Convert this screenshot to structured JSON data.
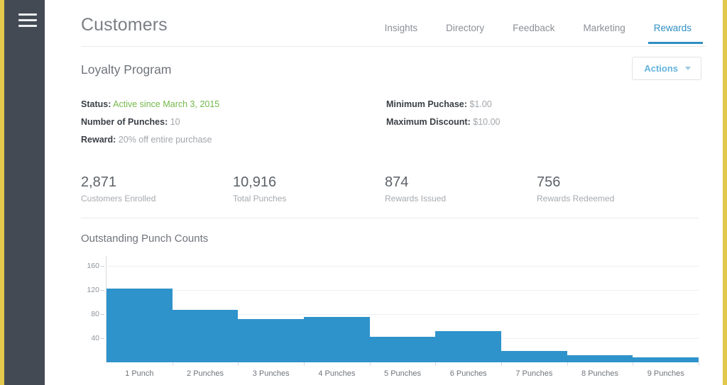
{
  "sidebar": {
    "menu_icon": "hamburger-menu-icon"
  },
  "header": {
    "title": "Customers",
    "tabs": [
      {
        "label": "Insights",
        "active": false
      },
      {
        "label": "Directory",
        "active": false
      },
      {
        "label": "Feedback",
        "active": false
      },
      {
        "label": "Marketing",
        "active": false
      },
      {
        "label": "Rewards",
        "active": true
      }
    ]
  },
  "section": {
    "title": "Loyalty Program",
    "actions_label": "Actions",
    "actions_icon": "chevron-down-icon"
  },
  "details": {
    "left": [
      {
        "label": "Status:",
        "value": "Active since March 3, 2015",
        "style": "green"
      },
      {
        "label": "Number of Punches:",
        "value": "10",
        "style": "muted"
      },
      {
        "label": "Reward:",
        "value": "20% off entire purchase",
        "style": "muted"
      }
    ],
    "right": [
      {
        "label": "Minimum Puchase:",
        "value": "$1.00",
        "style": "muted"
      },
      {
        "label": "Maximum Discount:",
        "value": "$10.00",
        "style": "muted"
      }
    ]
  },
  "stats": [
    {
      "value": "2,871",
      "label": "Customers Enrolled"
    },
    {
      "value": "10,916",
      "label": "Total Punches"
    },
    {
      "value": "874",
      "label": "Rewards Issued"
    },
    {
      "value": "756",
      "label": "Rewards Redeemed"
    }
  ],
  "chart_data": {
    "type": "bar",
    "title": "Outstanding Punch Counts",
    "xlabel": "",
    "ylabel": "",
    "categories": [
      "1 Punch",
      "2 Punches",
      "3 Punches",
      "4 Punches",
      "5 Punches",
      "6 Punches",
      "7 Punches",
      "8 Punches",
      "9 Punches"
    ],
    "values": [
      122,
      87,
      72,
      75,
      42,
      52,
      19,
      12,
      8
    ],
    "ylim": [
      0,
      176
    ],
    "yticks": [
      40,
      80,
      120,
      160
    ],
    "grid": true,
    "legend": false,
    "bar_color": "#2f93cb"
  },
  "colors": {
    "accent": "#2f8fc4",
    "bar": "#2f93cb",
    "sidebar": "#434a53",
    "frame_border": "#e2c84b",
    "status_green": "#74b84a"
  }
}
